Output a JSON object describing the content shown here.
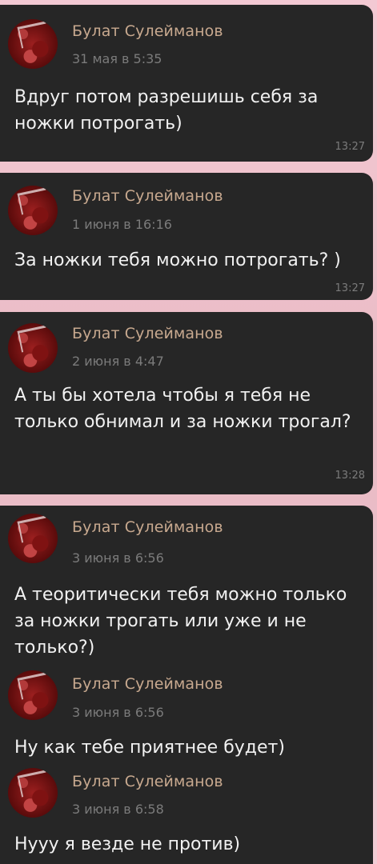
{
  "cards": [
    {
      "messages": [
        {
          "author": "Булат Сулейманов",
          "date": "31 мая в 5:35",
          "text": "Вдруг потом разрешишь себя за ножки потрогать)"
        }
      ],
      "time": "13:27"
    },
    {
      "messages": [
        {
          "author": "Булат Сулейманов",
          "date": "1 июня в 16:16",
          "text": "За ножки тебя можно потрогать? )"
        }
      ],
      "time": "13:27"
    },
    {
      "messages": [
        {
          "author": "Булат Сулейманов",
          "date": "2 июня в 4:47",
          "text": "А ты бы хотела чтобы я тебя не только обнимал и за ножки трогал?"
        }
      ],
      "time": "13:28"
    },
    {
      "messages": [
        {
          "author": "Булат Сулейманов",
          "date": "3 июня в 6:56",
          "text": "А теоритически тебя можно только за ножки трогать или уже и не только?)"
        },
        {
          "author": "Булат Сулейманов",
          "date": "3 июня в 6:56",
          "text": "Ну как тебе приятнее будет)"
        },
        {
          "author": "Булат Сулейманов",
          "date": "3 июня в 6:58",
          "text": "Нууу я везде не против)"
        }
      ]
    }
  ]
}
